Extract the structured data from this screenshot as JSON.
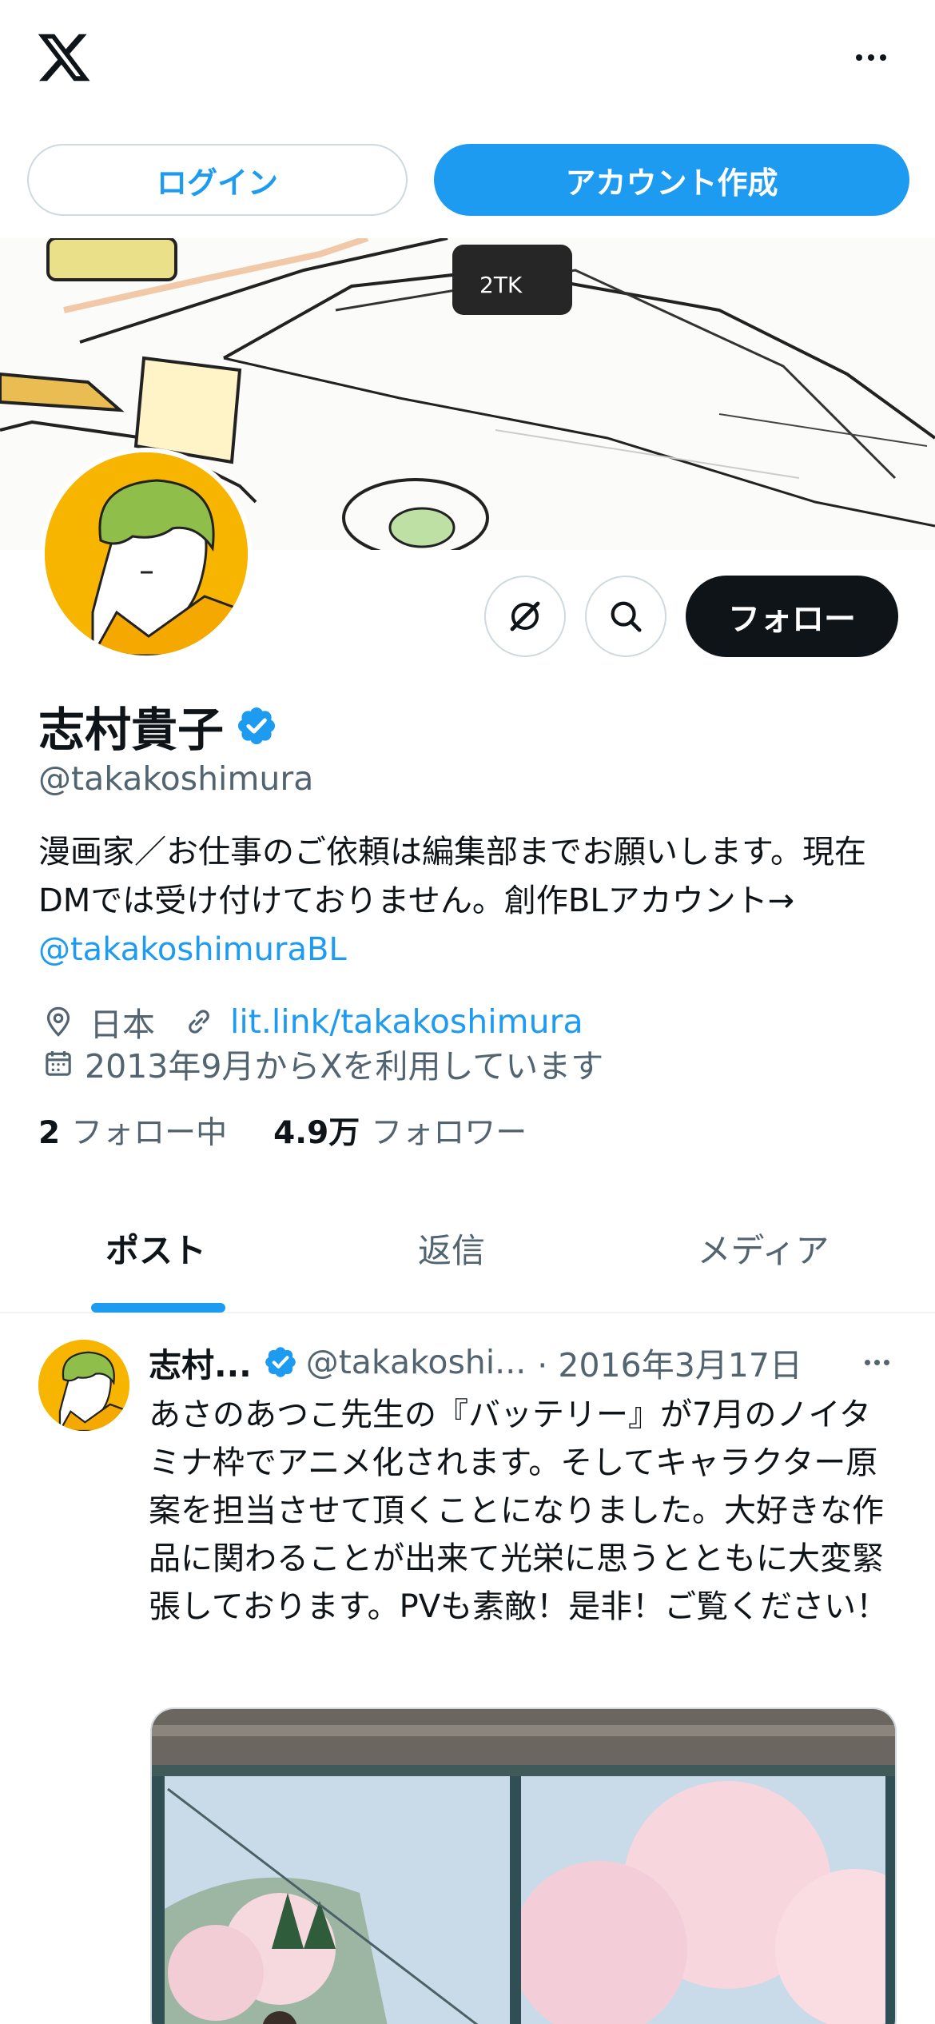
{
  "header": {
    "logo": "x-logo-icon",
    "more": "more-icon"
  },
  "auth": {
    "login_label": "ログイン",
    "signup_label": "アカウント作成"
  },
  "profile": {
    "actions": {
      "follow_label": "フォロー"
    },
    "name": "志村貴子",
    "handle": "@takakoshimura",
    "bio_text": "漫画家／お仕事のご依頼は編集部までお願いします。現在DMでは受け付けておりません。創作BLアカウント→",
    "bio_link": "@takakoshimuraBL",
    "location": "日本",
    "website": "lit.link/takakoshimura",
    "joined": "2013年9月からXを利用しています",
    "following_count": "2",
    "following_label": "フォロー中",
    "followers_count": "4.9万",
    "followers_label": "フォロワー"
  },
  "tabs": [
    {
      "label": "ポスト",
      "active": true
    },
    {
      "label": "返信",
      "active": false
    },
    {
      "label": "メディア",
      "active": false
    }
  ],
  "post": {
    "name": "志村...",
    "handle": "@takakoshi...",
    "date": "· 2016年3月17日",
    "text": "あさのあつこ先生の『バッテリー』が7月のノイタミナ枠でアニメ化されます。そしてキャラクター原案を担当させて頂くことになりました。大好きな作品に関わることが出来て光栄に思うとともに大変緊張しております。PVも素敵！是非！ご覧ください！"
  },
  "colors": {
    "accent": "#1d9bf0",
    "text_primary": "#0f1419",
    "text_secondary": "#536471",
    "border": "#cfd9de",
    "avatar_bg": "#f7b500"
  }
}
